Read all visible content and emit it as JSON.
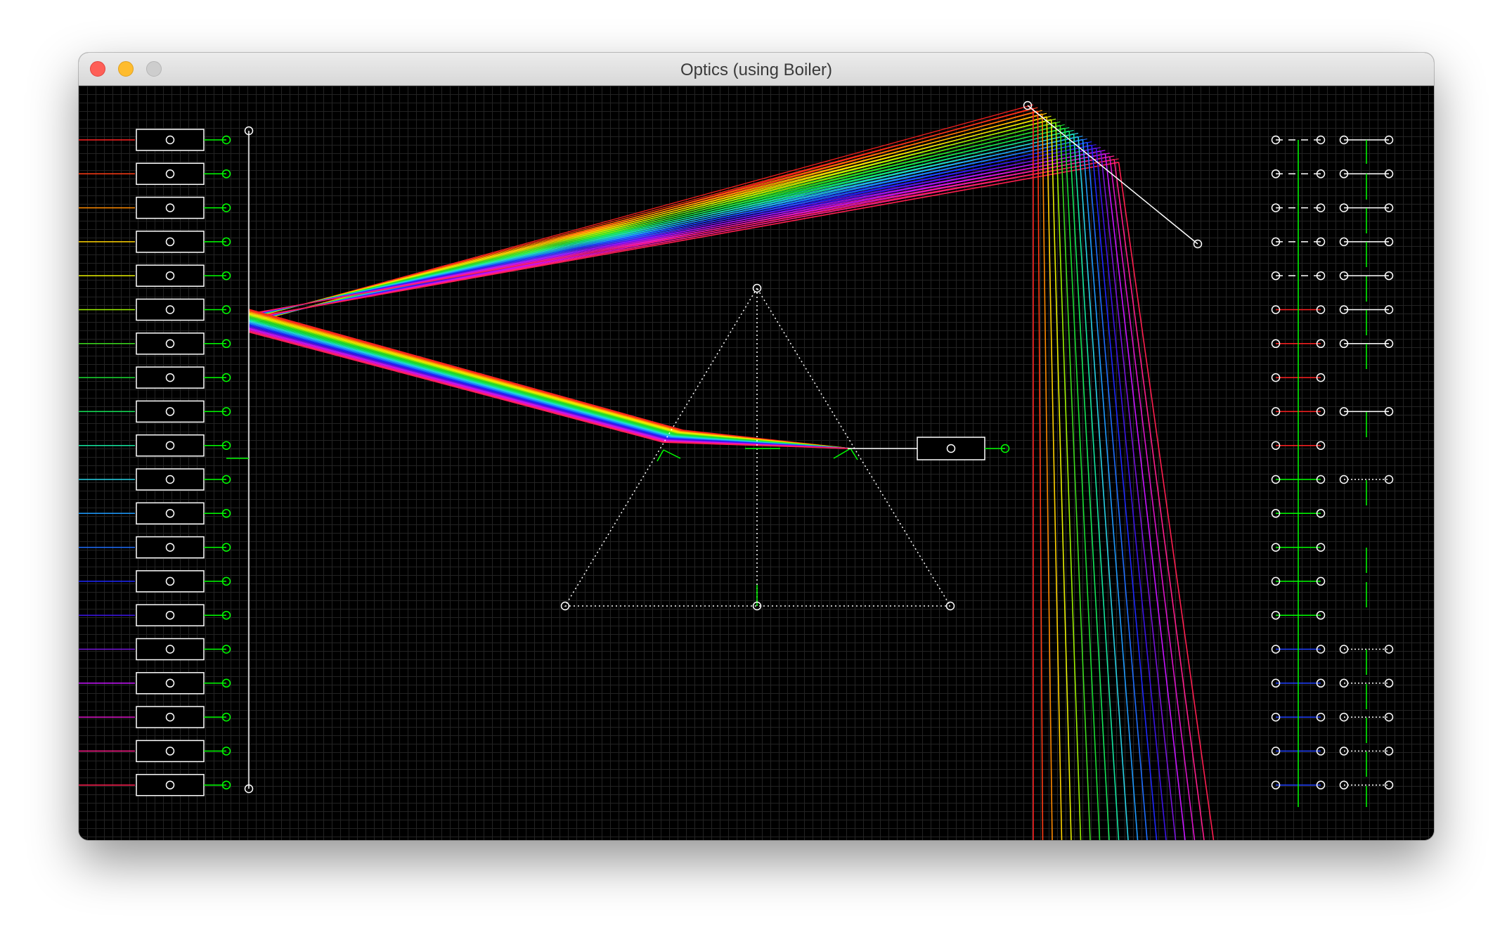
{
  "window": {
    "title": "Optics (using Boiler)",
    "traffic_lights": [
      "close-button",
      "minimize-button",
      "zoom-button"
    ]
  },
  "colors": {
    "background": "#000000",
    "grid": "#232323",
    "handle": "#ffffff",
    "connector": "#00ff00"
  },
  "spectrum_colors": [
    "#ff2020",
    "#ff3b14",
    "#ff8a00",
    "#ffd200",
    "#e8f000",
    "#9cf000",
    "#3cdc1e",
    "#19dc32",
    "#14e65a",
    "#14e6a0",
    "#28d2e6",
    "#1e9bff",
    "#1e6eff",
    "#1e28ff",
    "#3c14e6",
    "#7814dc",
    "#c814ff",
    "#dc14c8",
    "#ff1e8c",
    "#ff1e50"
  ],
  "panels": {
    "right_column_1": [
      "dashed",
      "dashed",
      "dashed",
      "dashed",
      "dashed",
      "red",
      "red",
      "red",
      "red",
      "red",
      "green",
      "green",
      "green",
      "green",
      "green",
      "blue",
      "blue",
      "blue",
      "blue",
      "blue"
    ],
    "right_column_2": [
      "white",
      "white",
      "white",
      "white",
      "white",
      "white",
      "white",
      "none",
      "white",
      "none",
      "dotted",
      "none",
      "none",
      "none",
      "none",
      "dotted",
      "dotted",
      "dotted",
      "dotted",
      "dotted"
    ]
  }
}
